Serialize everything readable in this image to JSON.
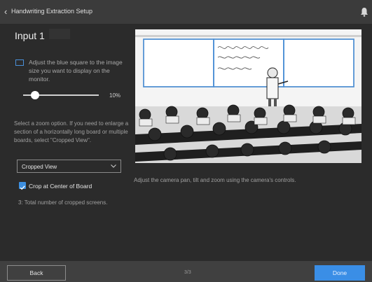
{
  "titlebar": {
    "back_icon": "chevron-left-icon",
    "title": "Handwriting Extraction Setup",
    "notify_icon": "bell-icon"
  },
  "heading": "Input 1",
  "size_hint": "Adjust the blue square to the image size you want to display on the monitor.",
  "zoom": {
    "value_fraction": 0.1,
    "label": "10%"
  },
  "zoom_hint": "Select a zoom option. If you need to enlarge a section of a horizontally long board or multiple boards, select \"Cropped View\".",
  "view_select": {
    "selected": "Cropped View"
  },
  "crop_center": {
    "label": "Crop at Center of Board",
    "checked": true
  },
  "crop_count": "3: Total number of cropped screens.",
  "camera_hint": "Adjust the camera pan, tilt and zoom using the camera's controls.",
  "footer": {
    "back": "Back",
    "page": "3/3",
    "done": "Done"
  },
  "colors": {
    "accent": "#3a8ee6",
    "crop_frame": "#4a90d9",
    "background": "#2b2b2b"
  }
}
